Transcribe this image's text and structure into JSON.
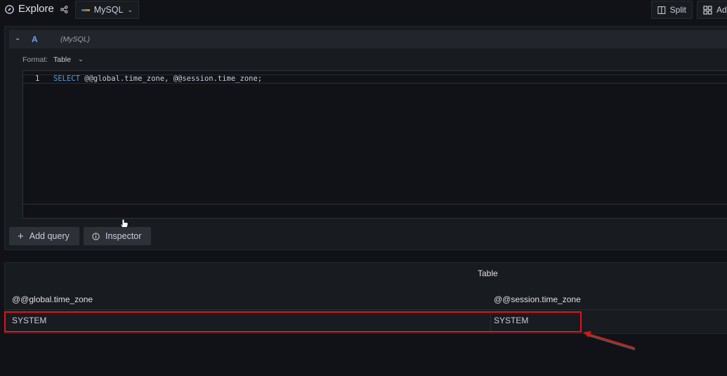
{
  "header": {
    "title": "Explore",
    "datasource": "MySQL",
    "split_label": "Split",
    "add_label": "Ad"
  },
  "query": {
    "ref_id": "A",
    "datasource_hint": "(MySQL)",
    "format_label": "Format:",
    "format_value": "Table",
    "line_number": "1",
    "sql_keyword": "SELECT",
    "sql_rest": " @@global.time_zone, @@session.time_zone;"
  },
  "buttons": {
    "add_query": "Add query",
    "inspector": "Inspector"
  },
  "results": {
    "title": "Table",
    "columns": [
      "@@global.time_zone",
      "@@session.time_zone"
    ],
    "rows": [
      [
        "SYSTEM",
        "SYSTEM"
      ]
    ]
  },
  "colors": {
    "accent": "#6e9fff",
    "highlight": "#e0141e"
  }
}
